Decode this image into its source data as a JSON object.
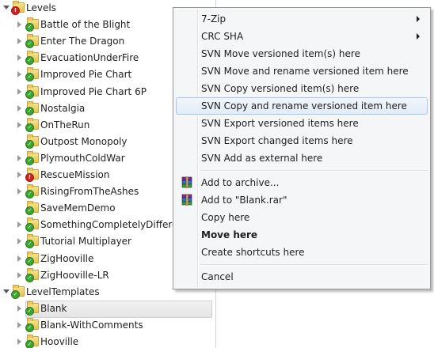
{
  "tree": {
    "items": [
      {
        "label": "Levels",
        "depth": 0,
        "expanded": true,
        "status": "err",
        "selected": false
      },
      {
        "label": "Battle of the Blight",
        "depth": 1,
        "expanded": false,
        "status": "ok",
        "selected": false
      },
      {
        "label": "Enter The Dragon",
        "depth": 1,
        "expanded": false,
        "status": "ok",
        "selected": false
      },
      {
        "label": "EvacuationUnderFire",
        "depth": 1,
        "expanded": false,
        "status": "ok",
        "selected": false
      },
      {
        "label": "Improved Pie Chart",
        "depth": 1,
        "expanded": false,
        "status": "ok",
        "selected": false
      },
      {
        "label": "Improved Pie Chart 6P",
        "depth": 1,
        "expanded": false,
        "status": "ok",
        "selected": false
      },
      {
        "label": "Nostalgia",
        "depth": 1,
        "expanded": false,
        "status": "ok",
        "selected": false
      },
      {
        "label": "OnTheRun",
        "depth": 1,
        "expanded": false,
        "status": "ok",
        "selected": false
      },
      {
        "label": "Outpost Monopoly",
        "depth": 1,
        "expanded": null,
        "status": "ok",
        "selected": false
      },
      {
        "label": "PlymouthColdWar",
        "depth": 1,
        "expanded": false,
        "status": "ok",
        "selected": false
      },
      {
        "label": "RescueMission",
        "depth": 1,
        "expanded": false,
        "status": "err",
        "selected": false
      },
      {
        "label": "RisingFromTheAshes",
        "depth": 1,
        "expanded": false,
        "status": "ok",
        "selected": false
      },
      {
        "label": "SaveMemDemo",
        "depth": 1,
        "expanded": null,
        "status": "ok",
        "selected": false
      },
      {
        "label": "SomethingCompletelyDifferent",
        "depth": 1,
        "expanded": false,
        "status": "ok",
        "selected": false
      },
      {
        "label": "Tutorial Multiplayer",
        "depth": 1,
        "expanded": false,
        "status": "ok",
        "selected": false
      },
      {
        "label": "ZigHooville",
        "depth": 1,
        "expanded": false,
        "status": "ok",
        "selected": false
      },
      {
        "label": "ZigHooville-LR",
        "depth": 1,
        "expanded": false,
        "status": "ok",
        "selected": false
      },
      {
        "label": "LevelTemplates",
        "depth": 0,
        "expanded": true,
        "status": "ok",
        "selected": false
      },
      {
        "label": "Blank",
        "depth": 1,
        "expanded": false,
        "status": "ok",
        "selected": true
      },
      {
        "label": "Blank-WithComments",
        "depth": 1,
        "expanded": false,
        "status": "ok",
        "selected": false
      },
      {
        "label": "Hooville",
        "depth": 1,
        "expanded": false,
        "status": "ok",
        "selected": false
      }
    ]
  },
  "menu": {
    "items": [
      {
        "type": "item",
        "label": "7-Zip",
        "submenu": true
      },
      {
        "type": "item",
        "label": "CRC SHA",
        "submenu": true
      },
      {
        "type": "item",
        "label": "SVN Move versioned item(s) here"
      },
      {
        "type": "item",
        "label": "SVN Move and rename versioned item here"
      },
      {
        "type": "item",
        "label": "SVN Copy versioned item(s) here"
      },
      {
        "type": "item",
        "label": "SVN Copy and rename versioned item here",
        "hover": true
      },
      {
        "type": "item",
        "label": "SVN Export versioned items here"
      },
      {
        "type": "item",
        "label": "SVN Export changed items here"
      },
      {
        "type": "item",
        "label": "SVN Add as external here"
      },
      {
        "type": "separator"
      },
      {
        "type": "item",
        "label": "Add to archive...",
        "icon": "winrar-icon"
      },
      {
        "type": "item",
        "label": "Add to \"Blank.rar\"",
        "icon": "winrar-icon"
      },
      {
        "type": "item",
        "label": "Copy here"
      },
      {
        "type": "item",
        "label": "Move here",
        "bold": true
      },
      {
        "type": "item",
        "label": "Create shortcuts here"
      },
      {
        "type": "separator"
      },
      {
        "type": "item",
        "label": "Cancel"
      }
    ]
  },
  "colors": {
    "status_ok": "#3aa52f",
    "status_err": "#d2231b",
    "menu_hover_border": "#a9c6eb"
  }
}
